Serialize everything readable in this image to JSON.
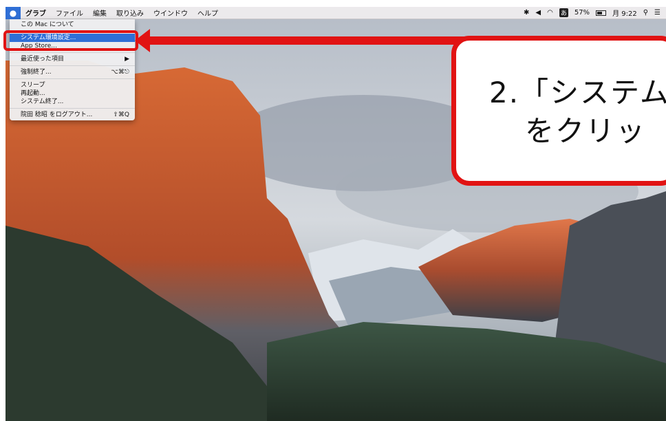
{
  "menubar": {
    "apple_icon": "apple-icon",
    "app_name": "グラブ",
    "items": [
      "ファイル",
      "編集",
      "取り込み",
      "ウインドウ",
      "ヘルプ"
    ],
    "status": {
      "bluetooth": "bluetooth-icon",
      "volume": "volume-icon",
      "wifi": "wifi-icon",
      "input_method": "あ",
      "battery_percent": "57%",
      "clock": "月 9:22",
      "search": "search-icon",
      "notifications": "notification-center-icon"
    }
  },
  "apple_menu": {
    "items": [
      {
        "label": "この Mac について",
        "shortcut": ""
      },
      {
        "label": "システム環境設定...",
        "shortcut": "",
        "selected": true
      },
      {
        "label": "App Store...",
        "shortcut": ""
      },
      {
        "label": "最近使った項目",
        "shortcut": "▶"
      },
      {
        "label": "強制終了...",
        "shortcut": "⌥⌘⎋"
      },
      {
        "label": "スリープ",
        "shortcut": ""
      },
      {
        "label": "再起動...",
        "shortcut": ""
      },
      {
        "label": "システム終了...",
        "shortcut": ""
      },
      {
        "label": "院田 稔昭 をログアウト...",
        "shortcut": "⇧⌘Q"
      }
    ]
  },
  "callout": {
    "line1": "2.「システム",
    "line2": "をクリッ"
  },
  "colors": {
    "highlight_red": "#e11313",
    "menu_selection_blue": "#2f6fd6"
  }
}
